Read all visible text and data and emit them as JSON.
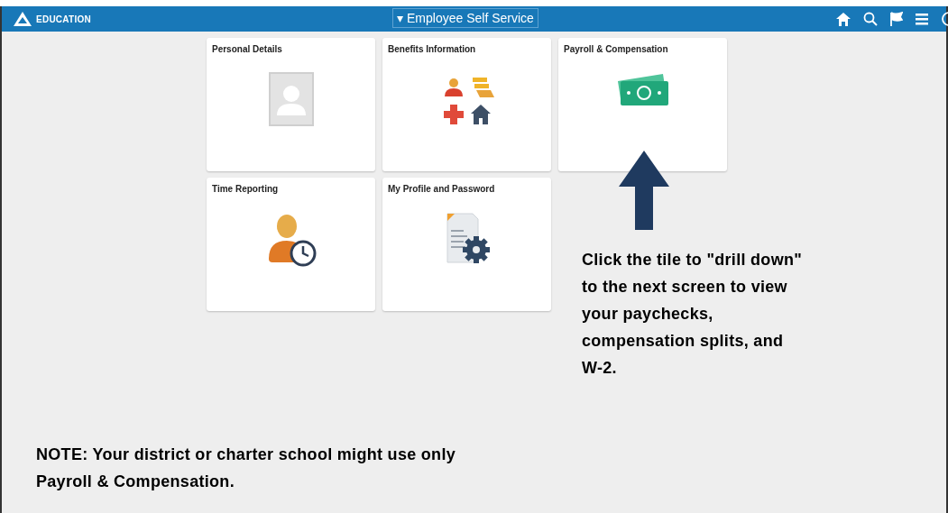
{
  "header": {
    "logo_text": "EDUCATION",
    "dropdown": {
      "caret": "▾",
      "label": "Employee Self Service"
    }
  },
  "tiles": [
    {
      "title": "Personal Details",
      "kind": "person"
    },
    {
      "title": "Benefits Information",
      "kind": "benefits"
    },
    {
      "title": "Payroll & Compensation",
      "kind": "money"
    },
    {
      "title": "Time Reporting",
      "kind": "time"
    },
    {
      "title": "My Profile and Password",
      "kind": "profile"
    }
  ],
  "callout": {
    "text": "Click the tile to \"drill down\" to the next screen to view your paychecks, compensation splits, and W-2."
  },
  "note": {
    "text": "**NOTE:** Your district or charter school might use only Payroll & Compensation."
  }
}
